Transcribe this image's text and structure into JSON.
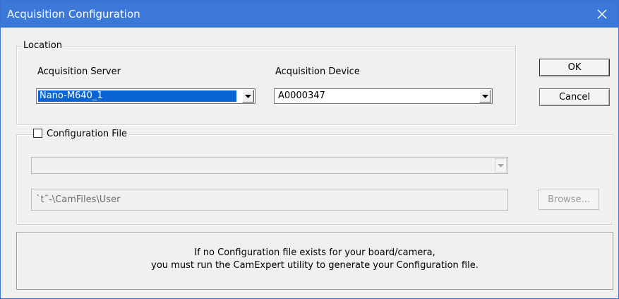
{
  "window": {
    "title": "Acquisition Configuration",
    "close_icon": "close-icon"
  },
  "location_group": {
    "legend": "Location",
    "server": {
      "label": "Acquisition Server",
      "value": "Nano-M640_1",
      "selected": true
    },
    "device": {
      "label": "Acquisition Device",
      "value": "A0000347"
    }
  },
  "buttons": {
    "ok": "OK",
    "cancel": "Cancel",
    "browse": "Browse..."
  },
  "config_group": {
    "legend": "Configuration File",
    "checked": false,
    "file_combo_value": "",
    "path": "`t˜-\\CamFiles\\User",
    "enabled": false
  },
  "info": {
    "line1": "If no Configuration file exists for your board/camera,",
    "line2": "you must run the CamExpert utility to generate your Configuration file."
  },
  "colors": {
    "titlebar": "#3c78d8",
    "dialog_bg": "#f0f0f0",
    "selection": "#0a64d4",
    "disabled_text": "#9a9a9a"
  }
}
